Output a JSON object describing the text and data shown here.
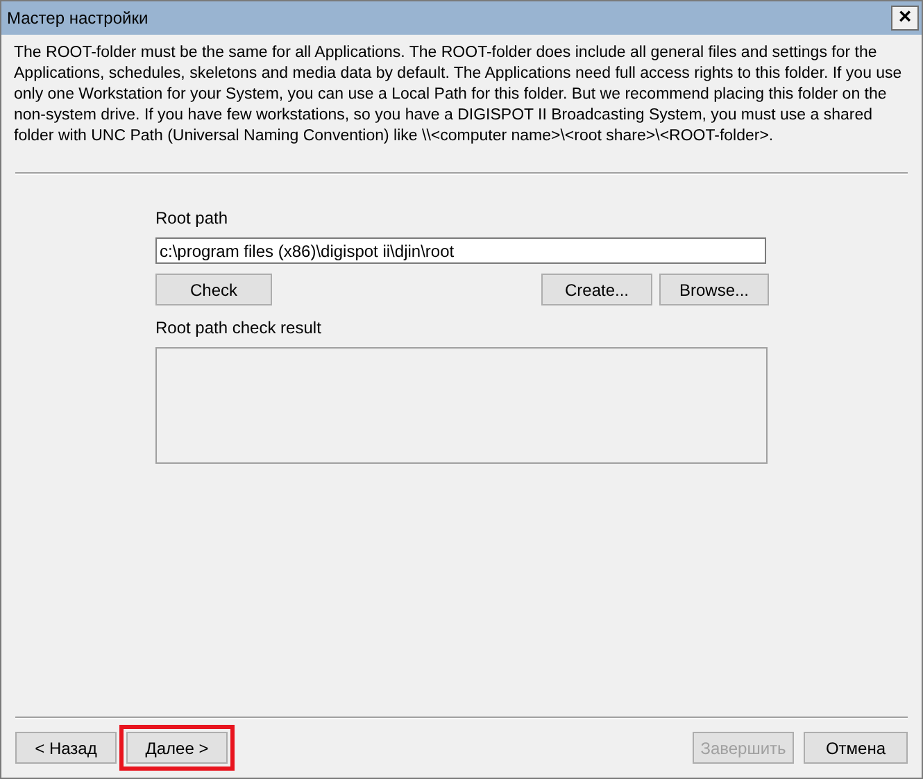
{
  "window": {
    "title": "Мастер настройки",
    "close": "×"
  },
  "description": "The ROOT-folder must be the same for all Applications. The ROOT-folder does include all general files and settings for the Applications, schedules, skeletons and media data by default.  The Applications need full access rights to this folder. If you use only one Workstation for your System, you can use a Local Path for this folder. But we recommend placing this folder on the non-system drive. If you have few workstations, so you have a DIGISPOT II Broadcasting System, you must use a shared folder with UNC Path (Universal Naming Convention) like \\\\<computer name>\\<root share>\\<ROOT-folder>.",
  "root_path": {
    "label": "Root path",
    "value": "c:\\program files (x86)\\digispot ii\\djin\\root"
  },
  "path_buttons": [
    {
      "label": "Check"
    },
    {
      "label": "Create..."
    },
    {
      "label": "Browse..."
    }
  ],
  "check_result": {
    "label": "Root path check result"
  },
  "footer_buttons": [
    {
      "label": "< Назад",
      "disabled": false,
      "highlighted": false
    },
    {
      "label": "Далее >",
      "disabled": false,
      "highlighted": true
    },
    {
      "label": "Завершить",
      "disabled": true,
      "highlighted": false
    },
    {
      "label": "Отмена",
      "disabled": false,
      "highlighted": false
    }
  ]
}
